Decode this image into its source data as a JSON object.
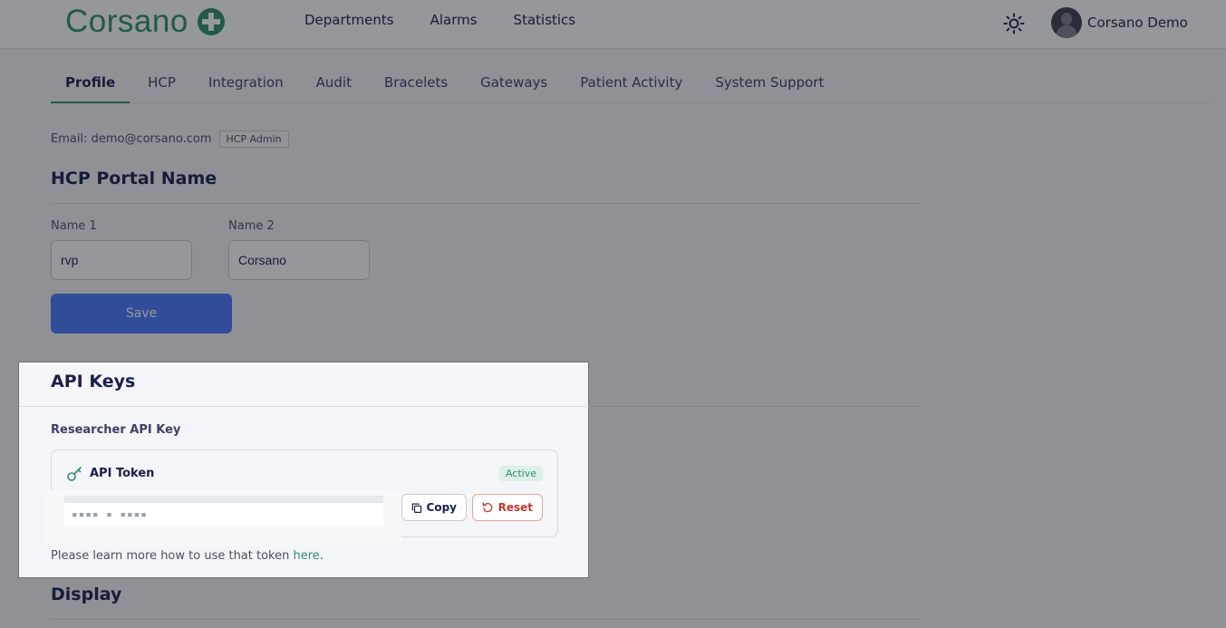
{
  "header": {
    "logo_text": "Corsano",
    "nav": [
      "Departments",
      "Alarms",
      "Statistics"
    ],
    "user_name": "Corsano Demo"
  },
  "tabs": [
    "Profile",
    "HCP",
    "Integration",
    "Audit",
    "Bracelets",
    "Gateways",
    "Patient Activity",
    "System Support"
  ],
  "active_tab": "Profile",
  "profile": {
    "email": "Email: demo@corsano.com",
    "role_badge": "HCP Admin",
    "portal_title": "HCP Portal Name",
    "name1_label": "Name 1",
    "name1_value": "rvp",
    "name2_label": "Name 2",
    "name2_value": "Corsano",
    "save_label": "Save"
  },
  "api_keys": {
    "title": "API Keys",
    "subtitle": "Researcher API Key",
    "token_label": "API Token",
    "status": "Active",
    "token_masked": "▪▪▪▪ ▪ ▪▪▪▪",
    "copy_label": "Copy",
    "reset_label": "Reset",
    "help_prefix": "Please learn more how to use that token ",
    "help_link": "here",
    "help_suffix": "."
  },
  "display": {
    "title": "Display"
  },
  "colors": {
    "brand": "#2f8f72",
    "primary_button": "#4a78ff",
    "danger": "#c0392b",
    "text": "#1a1f4b"
  }
}
